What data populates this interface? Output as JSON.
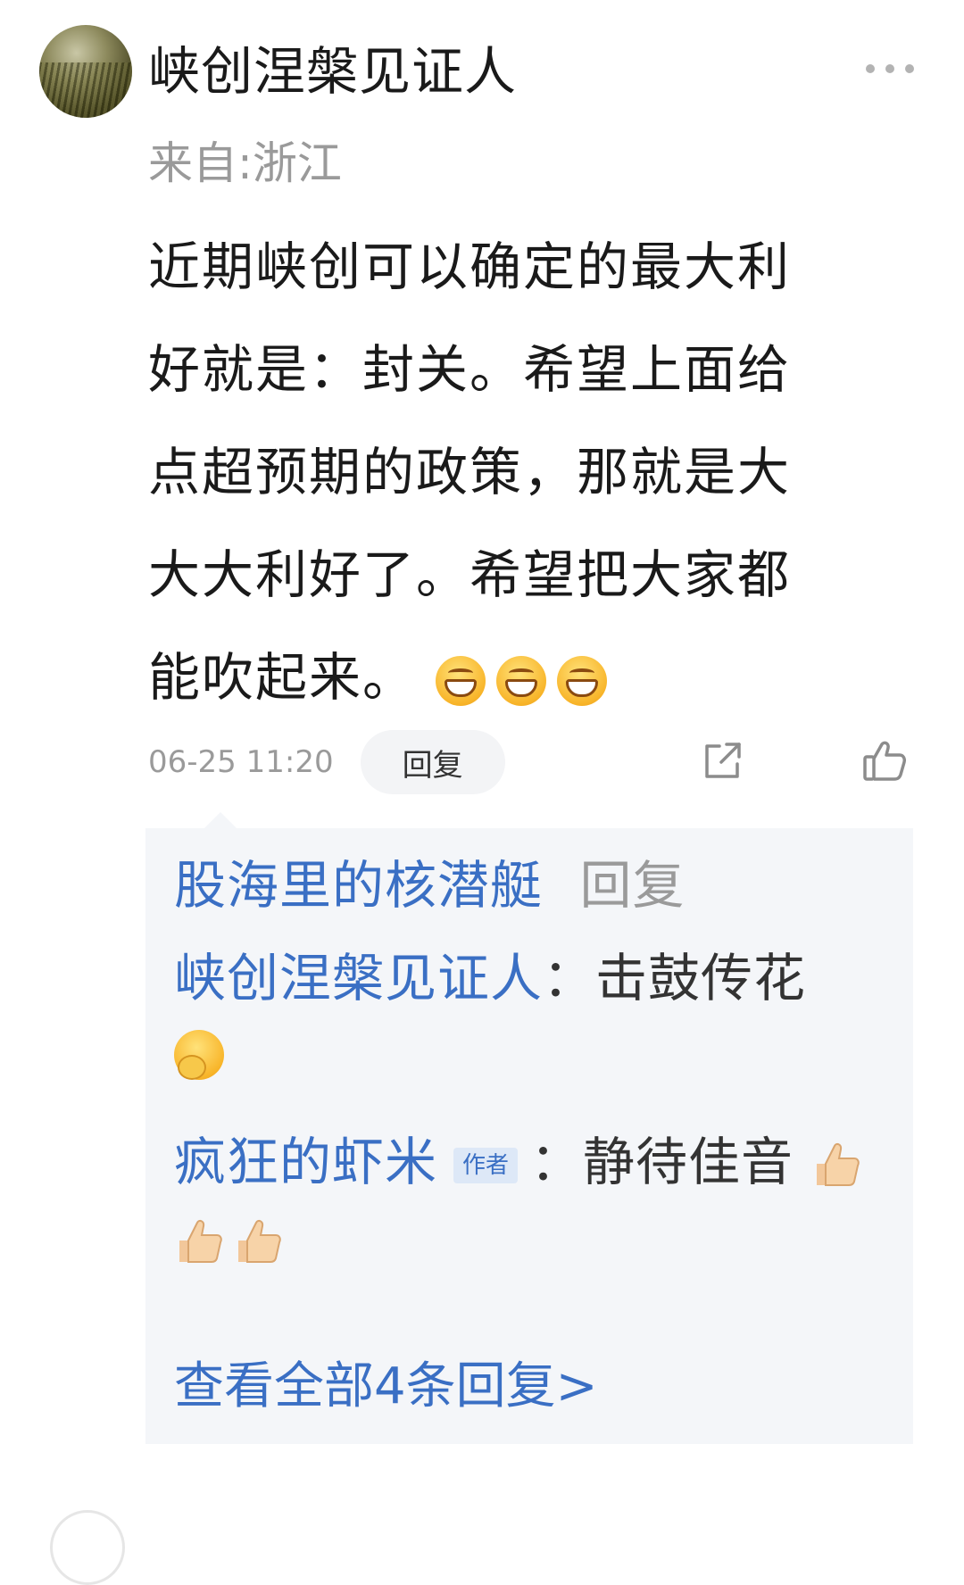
{
  "comment": {
    "username": "峡创涅槃见证人",
    "location": "来自:浙江",
    "content_lines": [
      "近期峡创可以确定的最大利",
      "好就是：封关。希望上面给",
      "点超预期的政策，那就是大",
      "大大利好了。希望把大家都",
      "能吹起来。"
    ],
    "emojis": [
      "grin-emoji",
      "grin-emoji",
      "grin-emoji"
    ],
    "timestamp": "06-25 11:20",
    "reply_label": "回复"
  },
  "replies": {
    "header_user": "股海里的核潜艇",
    "header_action": "回复",
    "items": [
      {
        "user": "峡创涅槃见证人",
        "separator": "：",
        "text": "击鼓传花"
      },
      {
        "user": "疯狂的虾米",
        "tag": "作者",
        "separator": "：",
        "text": "静待佳音"
      }
    ],
    "view_all": "查看全部4条回复>"
  },
  "colors": {
    "link": "#3a6fc4",
    "muted": "#9a9a9a",
    "reply_bg": "#f4f6f9"
  },
  "icons": [
    "more-icon",
    "share-icon",
    "like-icon",
    "thumbs-up-emoji",
    "blush-emoji"
  ]
}
